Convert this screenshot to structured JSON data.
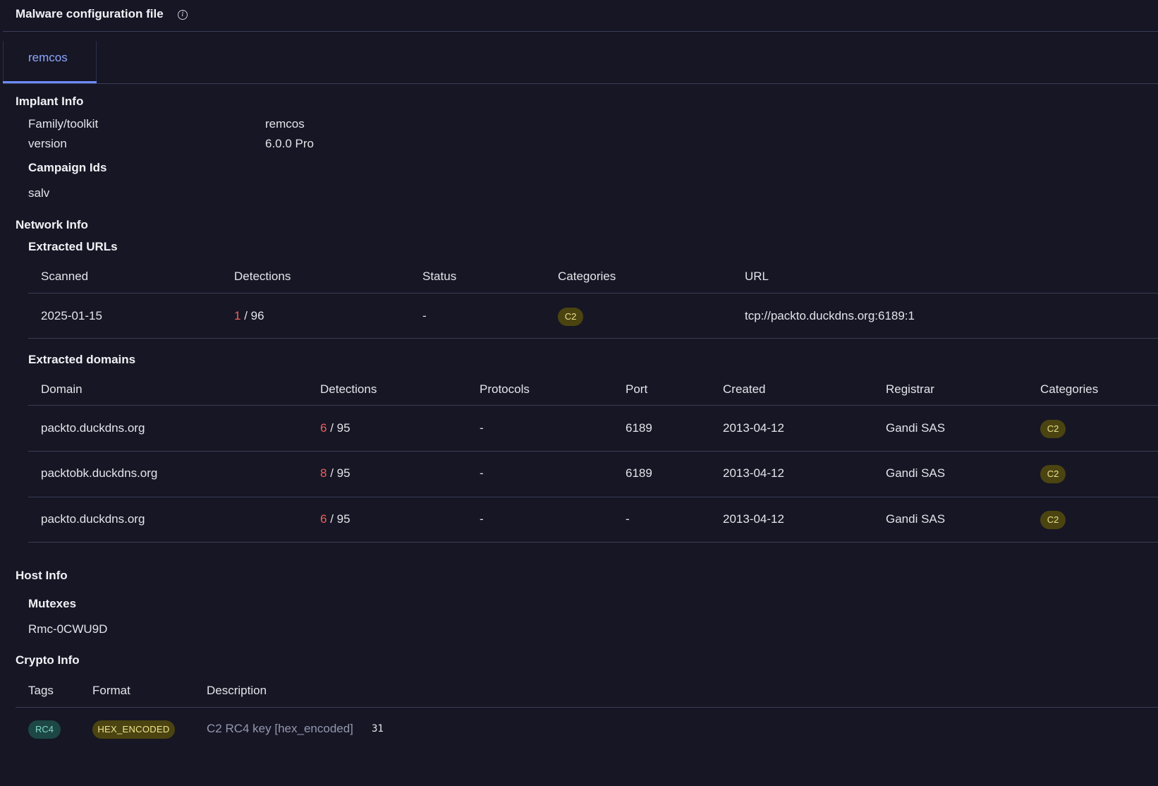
{
  "header": {
    "title": "Malware configuration file",
    "info_icon": "info-icon"
  },
  "tabs": [
    {
      "label": "remcos",
      "active": true
    }
  ],
  "implant_info": {
    "heading": "Implant Info",
    "rows": [
      {
        "label": "Family/toolkit",
        "value": "remcos"
      },
      {
        "label": "version",
        "value": "6.0.0 Pro"
      }
    ],
    "campaign_heading": "Campaign Ids",
    "campaign_ids": [
      "salv"
    ]
  },
  "network_info": {
    "heading": "Network Info",
    "urls": {
      "heading": "Extracted URLs",
      "columns": [
        "Scanned",
        "Detections",
        "Status",
        "Categories",
        "URL"
      ],
      "rows": [
        {
          "scanned": "2025-01-15",
          "det_hits": "1",
          "det_total": "/ 96",
          "status": "-",
          "category": "C2",
          "url": "tcp://packto.duckdns.org:6189:1"
        }
      ]
    },
    "domains": {
      "heading": "Extracted domains",
      "columns": [
        "Domain",
        "Detections",
        "Protocols",
        "Port",
        "Created",
        "Registrar",
        "Categories"
      ],
      "rows": [
        {
          "domain": "packto.duckdns.org",
          "det_hits": "6",
          "det_total": "/ 95",
          "protocols": "-",
          "port": "6189",
          "created": "2013-04-12",
          "registrar": "Gandi SAS",
          "category": "C2"
        },
        {
          "domain": "packtobk.duckdns.org",
          "det_hits": "8",
          "det_total": "/ 95",
          "protocols": "-",
          "port": "6189",
          "created": "2013-04-12",
          "registrar": "Gandi SAS",
          "category": "C2"
        },
        {
          "domain": "packto.duckdns.org",
          "det_hits": "6",
          "det_total": "/ 95",
          "protocols": "-",
          "port": "-",
          "created": "2013-04-12",
          "registrar": "Gandi SAS",
          "category": "C2"
        }
      ]
    }
  },
  "host_info": {
    "heading": "Host Info",
    "mutexes_heading": "Mutexes",
    "mutexes": [
      "Rmc-0CWU9D"
    ]
  },
  "crypto_info": {
    "heading": "Crypto Info",
    "columns": [
      "Tags",
      "Format",
      "Description"
    ],
    "rows": [
      {
        "tag": "RC4",
        "format": "HEX_ENCODED",
        "description": "C2 RC4 key [hex_encoded]",
        "size": "31"
      }
    ]
  },
  "colors": {
    "background": "#161624",
    "accent_tab": "#6c8cff",
    "detection_red": "#f0605c",
    "c2_badge_bg": "#4b4411",
    "rc4_badge_bg": "#1d4744"
  }
}
